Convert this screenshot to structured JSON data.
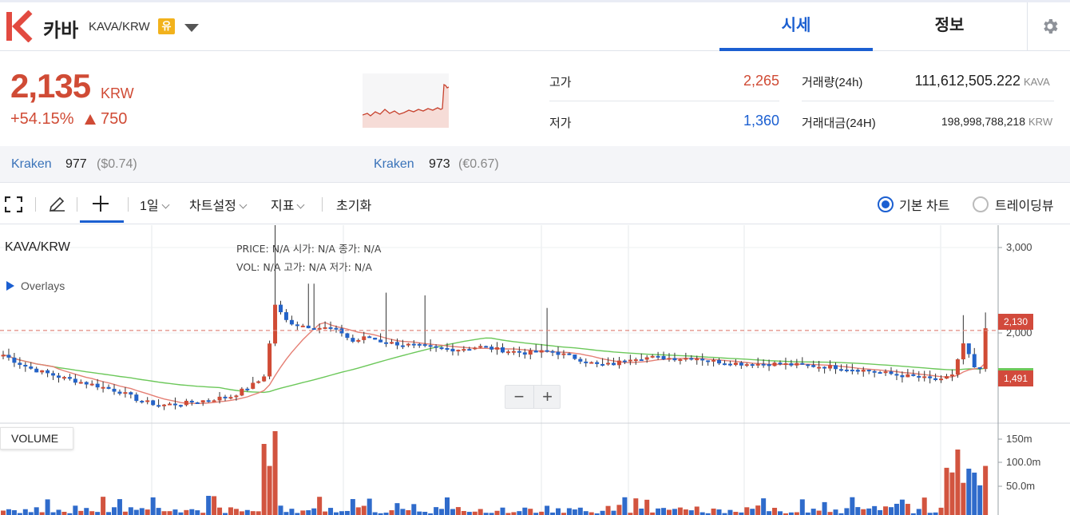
{
  "header": {
    "coin_name": "카바",
    "pair": "KAVA/KRW",
    "badge": "유",
    "tabs": [
      "시세",
      "정보"
    ],
    "brand_color": "#e24a40",
    "accent_color": "#1b5fd1"
  },
  "price": {
    "current": "2,135",
    "currency": "KRW",
    "change_pct": "+54.15%",
    "change_abs": "750",
    "up_color": "#d04b35"
  },
  "stats": {
    "high_label": "고가",
    "high_value": "2,265",
    "low_label": "저가",
    "low_value": "1,360",
    "volume_label": "거래량(24h)",
    "volume_value": "111,612,505.222",
    "volume_unit": "KAVA",
    "amount_label": "거래대금(24H)",
    "amount_value": "198,998,788,218",
    "amount_unit": "KRW"
  },
  "exchanges": [
    {
      "name": "Kraken",
      "price": "977",
      "sub": "($0.74)"
    },
    {
      "name": "Kraken",
      "price": "973",
      "sub": "(€0.67)"
    }
  ],
  "toolbar": {
    "interval": "1일",
    "chart_settings": "차트설정",
    "indicators": "지표",
    "reset": "초기화",
    "basic_chart": "기본 차트",
    "tradingview": "트레이딩뷰"
  },
  "chart": {
    "title": "KAVA/KRW",
    "overlays": "Overlays",
    "info_row1": "PRICE:  N/A    시가:  N/A    종가:  N/A",
    "info_row2": "VOL:    N/A    고가:  N/A    저가:  N/A",
    "volume_label": "VOLUME",
    "zoom_out": "−",
    "zoom_in": "+",
    "price_ticks": [
      "3,000",
      "2,000"
    ],
    "volume_ticks": [
      "150m",
      "100.0m",
      "50.0m"
    ],
    "last_price_tag": "2,130",
    "ma_tag": "1,491"
  },
  "chart_data": {
    "type": "candlestick",
    "y_range": [
      1100,
      3300
    ],
    "up_color": "#d04b35",
    "down_color": "#2463c8",
    "short_ma_color": "#e57f74",
    "long_ma_color": "#6cc85a",
    "candles_close_approx": [
      1900,
      1650,
      1500,
      1400,
      1300,
      1250,
      1230,
      1300,
      1380,
      1500,
      2300,
      2250,
      2050,
      2200,
      2080,
      1950,
      1980,
      1900,
      1950,
      1900,
      1880,
      1700,
      1750,
      1800,
      1700,
      1680,
      1700,
      1660,
      1640,
      1620,
      1580,
      1520,
      1500,
      2100,
      1700,
      2130
    ],
    "last_price": 2130,
    "ma_value": 1491
  }
}
